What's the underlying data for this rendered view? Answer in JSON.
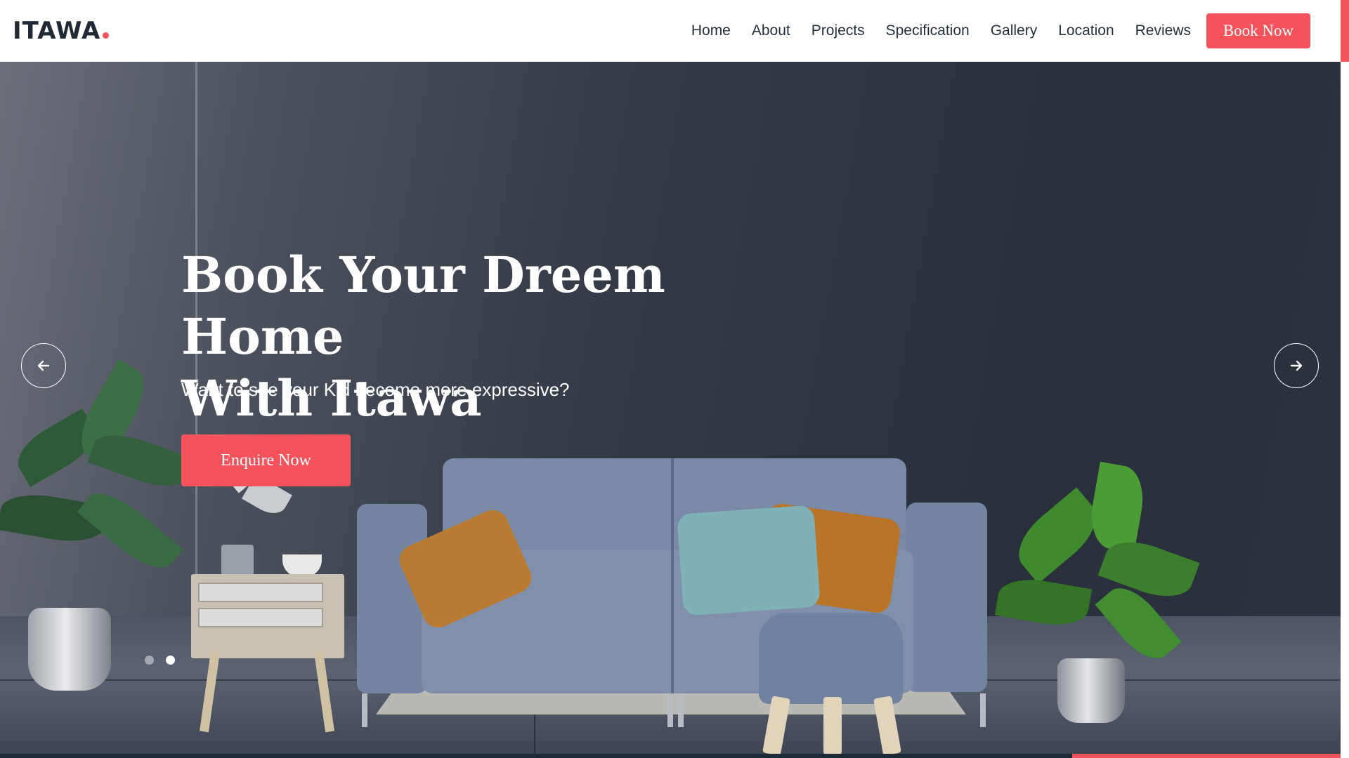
{
  "brand": {
    "logo_text": "ITAWA",
    "accent_color": "#f5535c",
    "dark_color": "#1f2a36"
  },
  "nav": {
    "items": [
      {
        "label": "Home"
      },
      {
        "label": "About"
      },
      {
        "label": "Projects"
      },
      {
        "label": "Specification"
      },
      {
        "label": "Gallery"
      },
      {
        "label": "Location"
      },
      {
        "label": "Reviews"
      }
    ],
    "cta_label": "Book Now"
  },
  "hero": {
    "title_line1": "Book Your Dreem Home",
    "title_line2": "With Itawa",
    "subtitle": "Want to see your Kid become more expressive?",
    "cta_label": "Enquire Now",
    "prev_icon": "arrow-left-icon",
    "next_icon": "arrow-right-icon",
    "slides": [
      {
        "active": false
      },
      {
        "active": true
      }
    ]
  }
}
